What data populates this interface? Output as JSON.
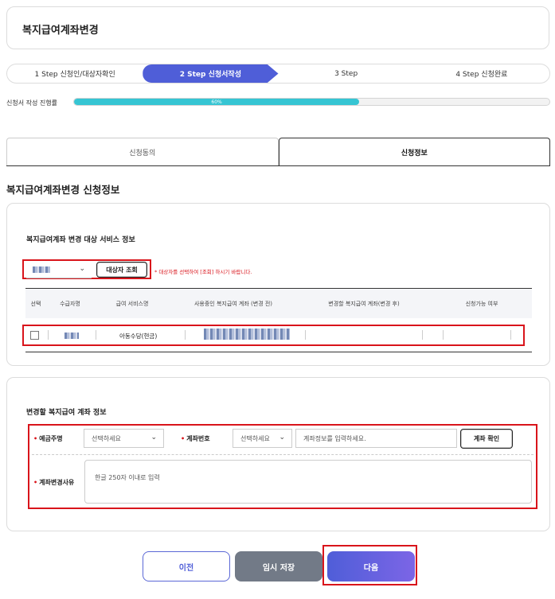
{
  "page": {
    "title": "복지급여계좌변경"
  },
  "steps": [
    {
      "label": "1 Step 신청인/대상자확인",
      "active": false
    },
    {
      "label": "2 Step 신청서작성",
      "active": true
    },
    {
      "label": "3 Step",
      "active": false
    },
    {
      "label": "4 Step 신청완료",
      "active": false
    }
  ],
  "progress": {
    "label": "신청서 작성 진행률",
    "value_text": "60%",
    "value": 60
  },
  "tabs": [
    {
      "label": "신청동의",
      "active": false
    },
    {
      "label": "신청정보",
      "active": true
    }
  ],
  "section_title": "복지급여계좌변경 신청정보",
  "service_info": {
    "heading": "복지급여계좌 변경 대상 서비스 정보",
    "lookup_button": "대상자 조회",
    "notice": "* 대상자를 선택하여 [조회] 하시기 바랍니다.",
    "columns": [
      "선택",
      "수급자명",
      "급여 서비스명",
      "사용중인 복지급여 계좌 (변경 전)",
      "변경할 복지급여 계좌(변경 후)",
      "신청가능 여부"
    ],
    "rows": [
      {
        "service": "아동수당(현금)"
      }
    ]
  },
  "account_info": {
    "heading": "변경할 복지급여 계좌 정보",
    "bank_label": "예금주명",
    "bank_select": "선택하세요",
    "account_label": "계좌번호",
    "account_select": "선택하세요",
    "account_placeholder": "계좌정보를 입력하세요.",
    "verify_button": "계좌 확인",
    "reason_label": "계좌변경사유",
    "reason_placeholder": "한글 250자 이내로 입력"
  },
  "buttons": {
    "prev": "이전",
    "temp_save": "임시 저장",
    "next": "다음"
  },
  "colors": {
    "accent": "#4f5ed8",
    "progress": "#36c5d3",
    "highlight": "#d9141b"
  }
}
